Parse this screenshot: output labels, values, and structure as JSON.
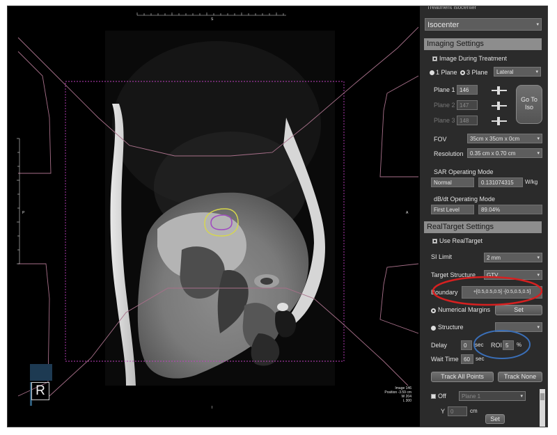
{
  "viewer": {
    "orientation_top": "S",
    "orientation_bottom": "I",
    "orientation_left": "P",
    "orientation_right": "A",
    "view_marker": "R",
    "info": {
      "image": "Image 146",
      "position": "Position -3.59 cm",
      "window": "W 204",
      "level": "L 300"
    }
  },
  "panel": {
    "top_group_label": "Treatment Isocenter",
    "isocenter_select": "Isocenter",
    "imaging": {
      "header": "Imaging Settings",
      "image_during_treatment": "Image During Treatment",
      "one_plane": "1 Plane",
      "three_plane": "3 Plane",
      "orientation": "Lateral",
      "plane1_label": "Plane 1",
      "plane1_value": "146",
      "plane2_label": "Plane 2",
      "plane2_value": "147",
      "plane3_label": "Plane 3",
      "plane3_value": "148",
      "goto_iso": "Go To Iso",
      "fov_label": "FOV",
      "fov_value": "35cm x 35cm x 0cm",
      "resolution_label": "Resolution",
      "resolution_value": "0.35 cm x 0.70 cm",
      "sar_label": "SAR Operating Mode",
      "sar_mode": "Normal",
      "sar_value": "0.131074315",
      "sar_unit": "W/kg",
      "dbdt_label": "dB/dt Operating Mode",
      "dbdt_mode": "First Level",
      "dbdt_value": "89.04%"
    },
    "realtarget": {
      "header": "RealTarget Settings",
      "use_realtarget": "Use RealTarget",
      "si_limit_label": "SI Limit",
      "si_limit_value": "2 mm",
      "target_structure_label": "Target Structure",
      "target_structure_value": "GTV",
      "boundary_label": "Boundary",
      "boundary_value": "+[0.5,0.5,0.5] -[0.5,0.5,0.5]",
      "numerical_margins": "Numerical Margins",
      "set_label": "Set",
      "structure_label": "Structure",
      "delay_label": "Delay",
      "delay_value": "0",
      "delay_unit": "sec",
      "roi_label": "ROI",
      "roi_value": "5",
      "roi_unit": "%",
      "wait_label": "Wait Time",
      "wait_value": "60",
      "wait_unit": "sec",
      "track_all": "Track All Points",
      "track_none": "Track None",
      "off_label": "Off",
      "plane_select": "Plane 1",
      "y_label": "Y",
      "y_value": "0",
      "y_unit": "cm",
      "set_label2": "Set"
    }
  },
  "annotation_colors": {
    "boundary_highlight": "#d62020",
    "roi_highlight": "#3a6fb8",
    "contour_outer": "#d8d84a",
    "contour_inner": "#9a3fb0",
    "fov_box": "#c040c0"
  }
}
